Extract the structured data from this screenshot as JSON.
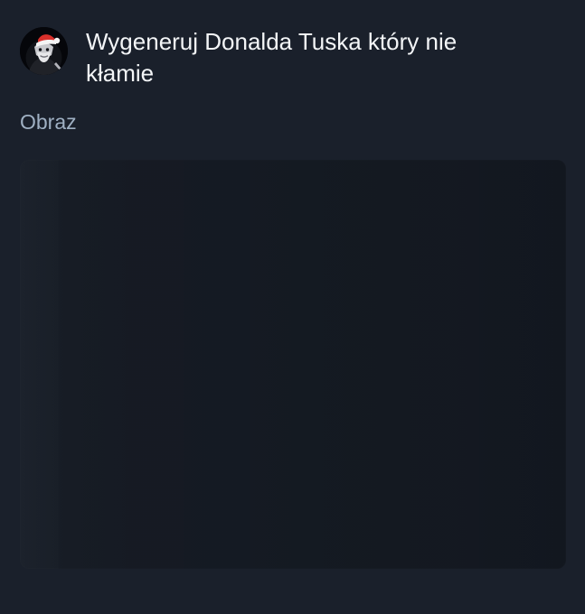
{
  "post": {
    "prompt": "Wygeneruj Donalda Tuska który nie kłamie",
    "media_label": "Obraz"
  },
  "avatar": {
    "icon": "avatar-santa-hat-icon"
  },
  "image_placeholder": {
    "state": "loading"
  },
  "colors": {
    "background": "#1a202b",
    "prompt_text": "#f3f5f7",
    "media_label": "#9fb0c3",
    "placeholder": "#151b24",
    "santa_hat": "#d9302b"
  }
}
